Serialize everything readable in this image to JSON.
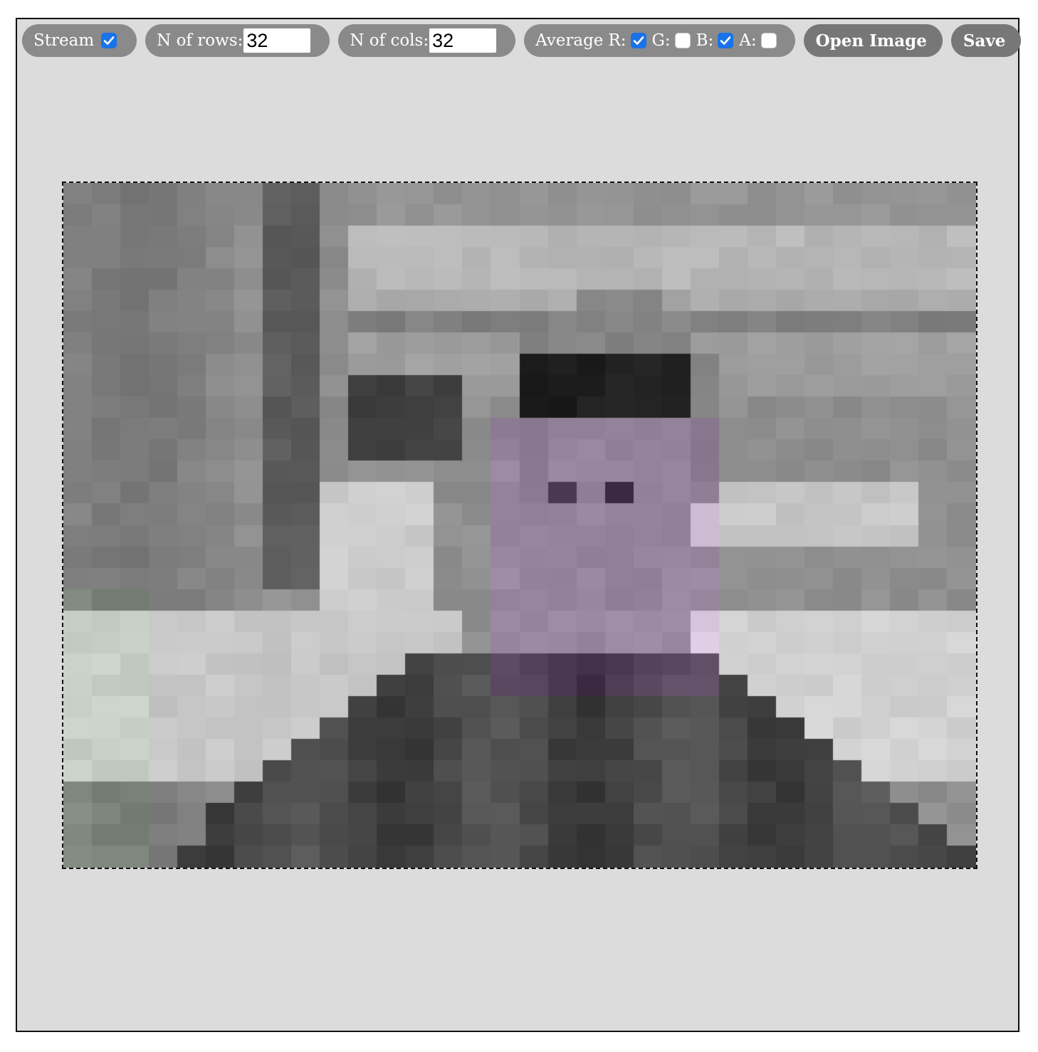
{
  "toolbar": {
    "stream": {
      "label": "Stream",
      "checked": true
    },
    "rows": {
      "label": "N of rows:",
      "value": "32"
    },
    "cols": {
      "label": "N of cols:",
      "value": "32"
    },
    "average": {
      "label": "Average",
      "channels": [
        {
          "label": "R:",
          "checked": true
        },
        {
          "label": "G:",
          "checked": false
        },
        {
          "label": "B:",
          "checked": true
        },
        {
          "label": "A:",
          "checked": false
        }
      ]
    },
    "open_image_label": "Open Image",
    "save_label": "Save"
  },
  "colors": {
    "app_background": "#dcdcdc",
    "pill_background": "#8a8a8a",
    "button_background": "#777777",
    "checkbox_checked": "#1a73e8"
  },
  "image": {
    "description_icon": "pixelated-webcam-image",
    "grid_rows": 32,
    "grid_cols": 32
  }
}
